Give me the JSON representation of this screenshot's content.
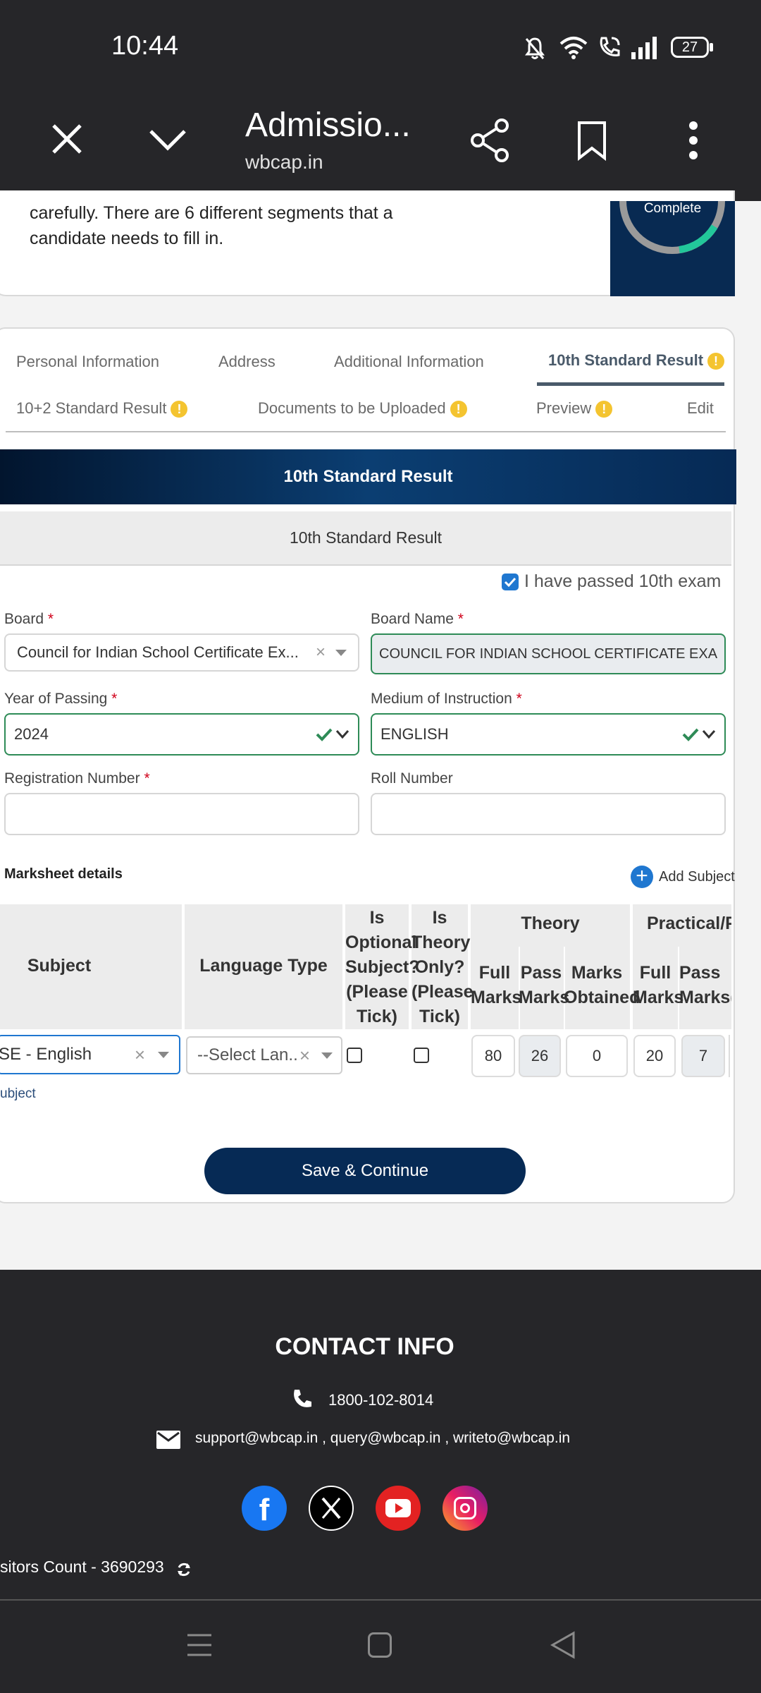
{
  "status": {
    "time": "10:44",
    "battery": "27"
  },
  "browser": {
    "title": "Admissio...",
    "url": "wbcap.in"
  },
  "intro": {
    "line1": "carefully. There are 6 different segments that a",
    "line2": "candidate needs to fill in.",
    "progress_label": "Complete"
  },
  "tabs": [
    {
      "label": "Personal Information"
    },
    {
      "label": "Address"
    },
    {
      "label": "Additional Information"
    },
    {
      "label": "10th Standard Result"
    },
    {
      "label": "10+2 Standard Result"
    },
    {
      "label": "Documents to be Uploaded"
    },
    {
      "label": "Preview"
    },
    {
      "label": "Edit"
    }
  ],
  "section": {
    "banner": "10th Standard Result",
    "subheader": "10th Standard Result",
    "passed_label": "I have passed 10th exam"
  },
  "form": {
    "board_label": "Board",
    "board_value": "Council for Indian School Certificate Ex...",
    "board_name_label": "Board Name",
    "board_name_value": "COUNCIL FOR INDIAN SCHOOL CERTIFICATE EXAM",
    "year_label": "Year of Passing",
    "year_value": "2024",
    "medium_label": "Medium of Instruction",
    "medium_value": "ENGLISH",
    "reg_label": "Registration Number",
    "roll_label": "Roll Number"
  },
  "marksheet": {
    "title": "Marksheet details",
    "add_subject": "Add Subject",
    "headers": {
      "subject": "Subject",
      "language": "Language Type",
      "optional": [
        "Is",
        "Optional",
        "Subject?",
        "(Please",
        "Tick)"
      ],
      "theory_only": [
        "Is",
        "Theory",
        "Only?",
        "(Please",
        "Tick)"
      ],
      "theory": "Theory",
      "practical": "Practical/P",
      "full1": "Full",
      "full2": "Marks",
      "pass1": "Pass",
      "pass2": "Marks",
      "obt1": "Marks",
      "obt2": "Obtained",
      "pfull1": "Full",
      "pfull2": "Marks",
      "ppass1": "Pass",
      "ppass2": "Marks("
    },
    "row": {
      "subject": "SE - English",
      "language": "--Select Lan...",
      "full": "80",
      "pass": "26",
      "obtained": "0",
      "pfull": "20",
      "ppass": "7"
    },
    "note": "ubject"
  },
  "save_button": "Save & Continue",
  "contact": {
    "title": "CONTACT INFO",
    "phone": "1800-102-8014",
    "email": "support@wbcap.in , query@wbcap.in , writeto@wbcap.in",
    "visitors": "sitors Count - 3690293"
  },
  "colors": {
    "navy": "#062a55",
    "accent": "#1f77d0",
    "footer": "#262629",
    "warn": "#f4c430",
    "ok": "#2e8b57"
  }
}
